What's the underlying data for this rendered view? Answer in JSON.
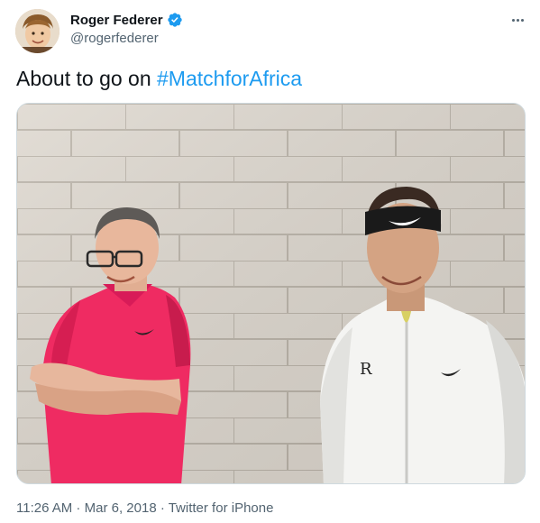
{
  "tweet": {
    "author": {
      "display_name": "Roger Federer",
      "handle": "@rogerfederer",
      "verified": true,
      "verified_color": "#1d9bf0"
    },
    "text_prefix": "About to go on ",
    "hashtag": "#MatchforAfrica",
    "hashtag_color": "#1d9bf0",
    "time": "11:26 AM",
    "separator": " · ",
    "date": "Mar 6, 2018",
    "source": "Twitter for iPhone",
    "icons": [
      "verified-badge-icon",
      "more-options-icon"
    ]
  }
}
